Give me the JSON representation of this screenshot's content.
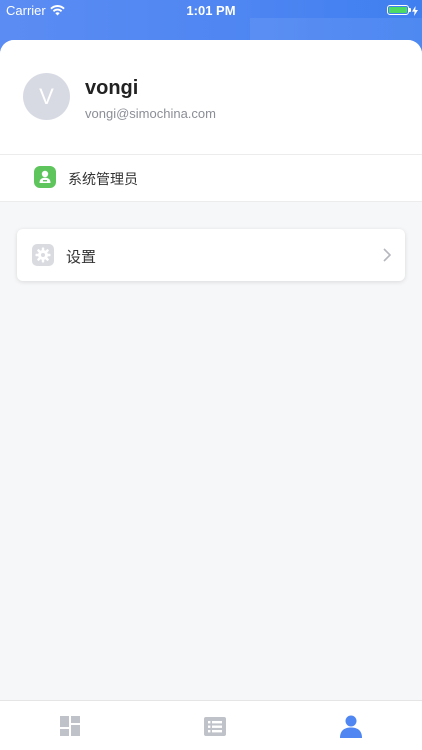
{
  "status_bar": {
    "carrier": "Carrier",
    "time": "1:01 PM",
    "battery_level": 1.0
  },
  "profile": {
    "avatar_initial": "V",
    "name": "vongi",
    "email": "vongi@simochina.com"
  },
  "role": {
    "label": "系统管理员",
    "icon": "admin-user-icon"
  },
  "menu": {
    "settings_label": "设置",
    "settings_icon": "gear-icon"
  },
  "tab_bar": {
    "tabs": [
      {
        "icon": "dashboard-icon",
        "active": false
      },
      {
        "icon": "list-icon",
        "active": false
      },
      {
        "icon": "person-icon",
        "active": true
      }
    ]
  },
  "colors": {
    "accent": "#4f86f2",
    "inactive_tab": "#bfc2c8",
    "role_green": "#5ec55d"
  }
}
